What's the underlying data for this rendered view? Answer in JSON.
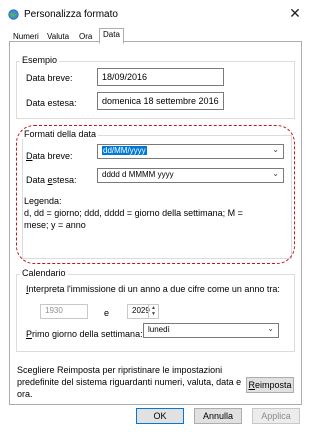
{
  "window": {
    "title": "Personalizza formato",
    "close_glyph": "✕",
    "icon": "globe-icon"
  },
  "tabs": [
    {
      "label": "Numeri"
    },
    {
      "label": "Valuta"
    },
    {
      "label": "Ora"
    },
    {
      "label": "Data"
    }
  ],
  "active_tab": "Data",
  "esempio": {
    "heading": "Esempio",
    "short_label": "Data breve:",
    "short_value": "18/09/2016",
    "long_label": "Data estesa:",
    "long_value": "domenica 18 settembre 2016"
  },
  "formati": {
    "heading": "Formati della data",
    "short_label": "Data breve:",
    "short_value": "dd/MM/yyyy",
    "long_label": "Data estesa:",
    "long_value": "dddd d MMMM yyyy",
    "legend_title": "Legenda:",
    "legend_line1": "d, dd = giorno;  ddd, dddd = giorno della settimana;  M =",
    "legend_line2": "mese;  y = anno"
  },
  "calendario": {
    "heading": "Calendario",
    "two_digit_text": "Interpreta l'immissione di un anno a due cifre come un anno tra:",
    "year_from": "1930",
    "and_label": "e",
    "year_to": "2029",
    "first_day_label": "Primo giorno della settimana:",
    "first_day_value": "lunedì"
  },
  "reset": {
    "text_line1": "Scegliere Reimposta per ripristinare le impostazioni",
    "text_line2": "predefinite del sistema riguardanti numeri, valuta, data e",
    "text_line3": "ora.",
    "button": "Reimposta"
  },
  "buttons": {
    "ok": "OK",
    "cancel": "Annulla",
    "apply": "Applica"
  },
  "colors": {
    "accent": "#0078d7",
    "annotation": "#c0161a"
  }
}
